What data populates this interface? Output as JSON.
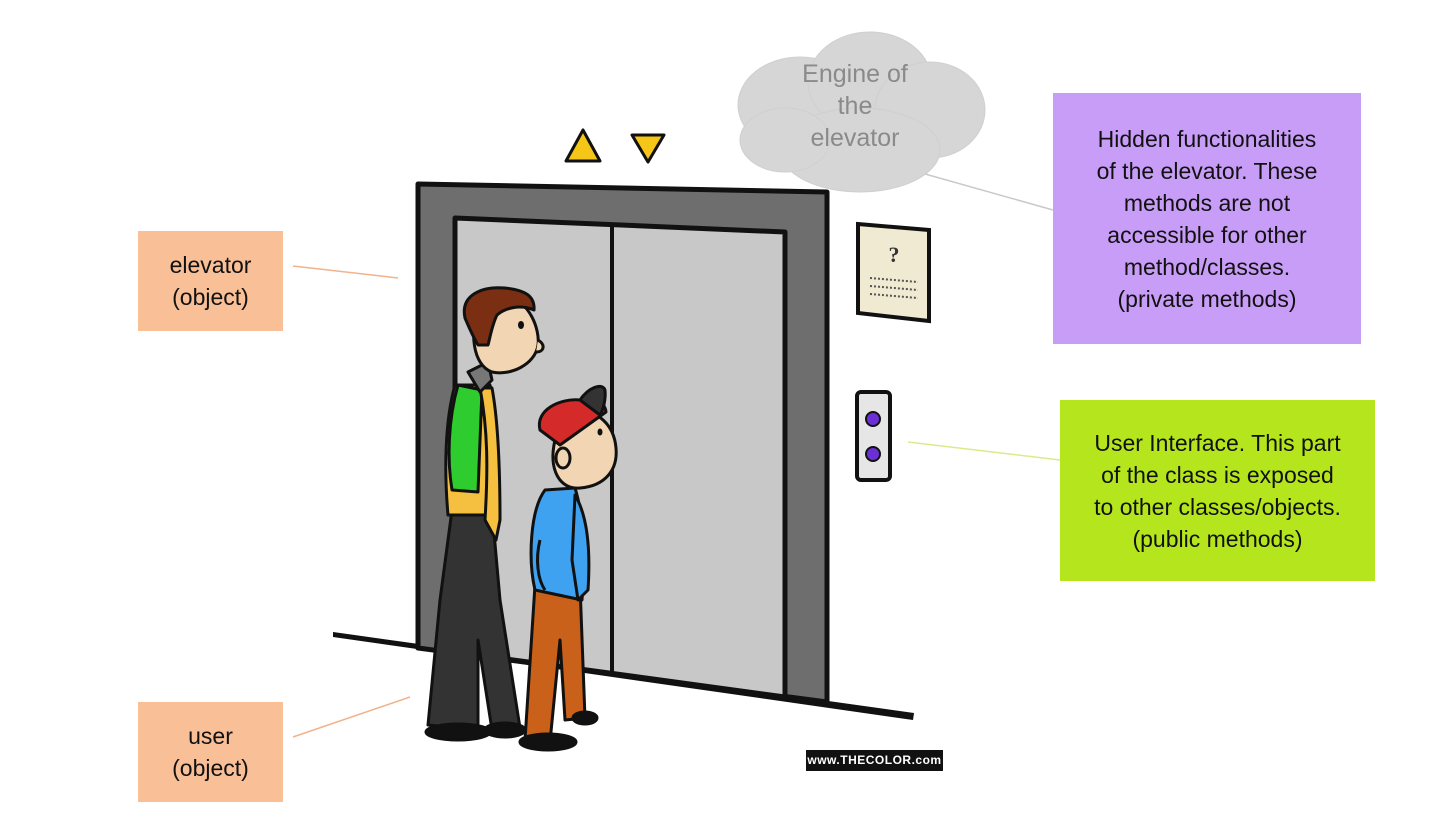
{
  "labels": {
    "elevator_line1": "elevator",
    "elevator_line2": "(object)",
    "user_line1": "user",
    "user_line2": "(object)",
    "cloud_line1": "Engine of",
    "cloud_line2": "the",
    "cloud_line3": "elevator",
    "hidden_line1": "Hidden functionalities",
    "hidden_line2": "of the elevator. These",
    "hidden_line3": "methods are not",
    "hidden_line4": "accessible for other",
    "hidden_line5": "method/classes.",
    "hidden_line6": "(private methods)",
    "ui_line1": "User Interface. This part",
    "ui_line2": "of the class is exposed",
    "ui_line3": "to other classes/objects.",
    "ui_line4": "(public methods)",
    "sign_symbol": "?",
    "watermark": "www.THECOLOR.com"
  },
  "colors": {
    "object_box": "#f9bf97",
    "private_box": "#c89df7",
    "public_box": "#b5e61d",
    "cloud": "#d6d6d6",
    "frame": "#6e6e6e",
    "door": "#c8c8c8",
    "arrow": "#f5c518",
    "button": "#6b2fd6"
  }
}
